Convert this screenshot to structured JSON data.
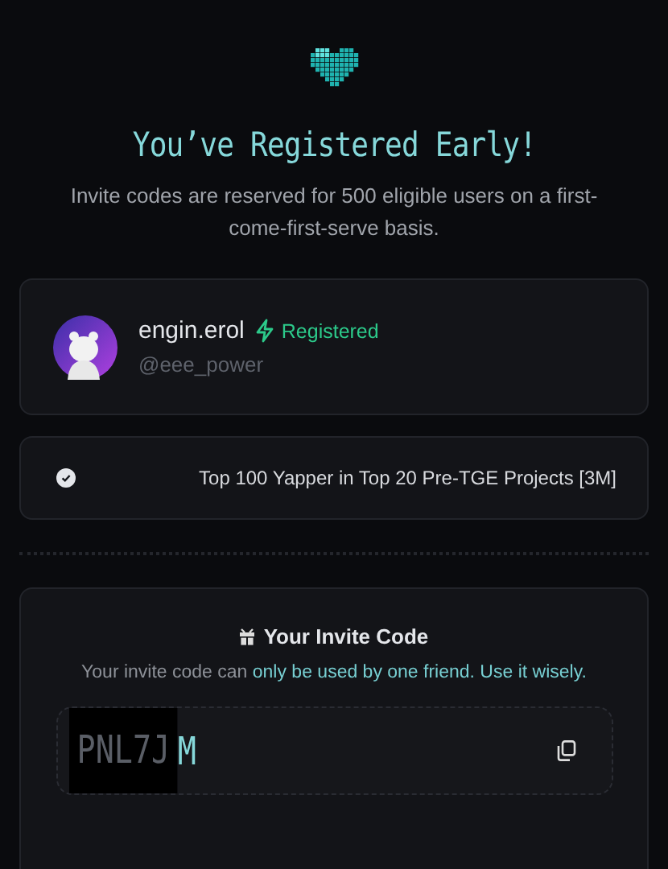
{
  "header": {
    "title": "You’ve Registered Early!",
    "subtitle": "Invite codes are reserved for 500 eligible users on a first-come-first-serve basis."
  },
  "profile": {
    "name": "engin.erol",
    "registered": true,
    "status": "Registered",
    "handle": "@eee_power"
  },
  "achievements": [
    {
      "label": "Top 100 Yapper in Top 20 Pre-TGE Projects [3M]",
      "checked": true
    }
  ],
  "invite": {
    "title": "Your Invite Code",
    "note": "Your invite code can **only be used by one friend. Use it wisely.**",
    "code_hidden": "PNL7J",
    "code_shown": "M"
  }
}
